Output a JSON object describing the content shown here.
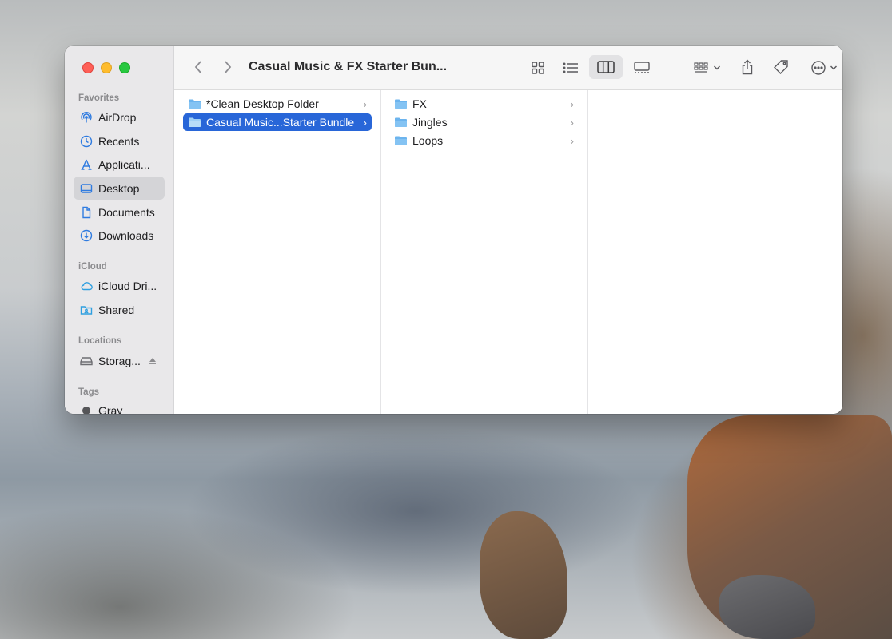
{
  "window": {
    "title": "Casual Music & FX Starter Bun..."
  },
  "sidebar": {
    "favorites_header": "Favorites",
    "favorites": [
      {
        "label": "AirDrop",
        "icon": "airdrop-icon"
      },
      {
        "label": "Recents",
        "icon": "clock-icon"
      },
      {
        "label": "Applicati...",
        "icon": "applications-icon"
      },
      {
        "label": "Desktop",
        "icon": "desktop-icon",
        "selected": true
      },
      {
        "label": "Documents",
        "icon": "document-icon"
      },
      {
        "label": "Downloads",
        "icon": "download-icon"
      }
    ],
    "icloud_header": "iCloud",
    "icloud": [
      {
        "label": "iCloud Dri...",
        "icon": "cloud-icon"
      },
      {
        "label": "Shared",
        "icon": "shared-folder-icon"
      }
    ],
    "locations_header": "Locations",
    "locations": [
      {
        "label": "Storag...",
        "icon": "disk-icon"
      }
    ],
    "tags_header": "Tags",
    "tags": [
      {
        "label": "Gray",
        "color": "#8e8e93"
      }
    ]
  },
  "columns": {
    "col1": [
      {
        "name": "*Clean Desktop Folder"
      },
      {
        "name": "Casual Music...Starter Bundle",
        "selected": true
      }
    ],
    "col2": [
      {
        "name": "FX"
      },
      {
        "name": "Jingles"
      },
      {
        "name": "Loops"
      }
    ]
  },
  "colors": {
    "selection": "#2866d8",
    "folder": "#6cb4ee"
  }
}
